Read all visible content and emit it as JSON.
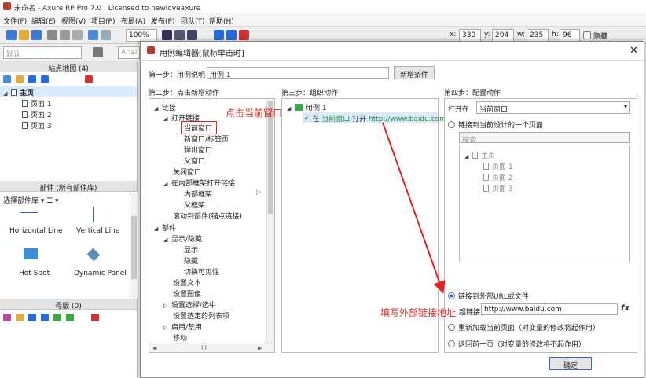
{
  "window": {
    "title": "未命名 - Axure RP Pro 7.0 : Licensed to newloveaxure"
  },
  "menu": [
    "文件(F)",
    "编辑(E)",
    "视图(V)",
    "项目(P)",
    "布局(A)",
    "发布(P)",
    "团队(T)",
    "帮助(H)"
  ],
  "toolbar": {
    "zoom": "100%",
    "x_label": "x:",
    "x": "330",
    "y_label": "y:",
    "y": "204",
    "w_label": "w:",
    "w": "235",
    "h_label": "h:",
    "h": "96",
    "hide_label": "隐藏",
    "style_default": "默认",
    "font": "Arial"
  },
  "sitemap": {
    "title": "站点地图 (4)",
    "root": "主页",
    "pages": [
      "页面 1",
      "页面 2",
      "页面 3"
    ]
  },
  "widgets": {
    "title": "部件 (所有部件库)",
    "library_label": "选择部件库",
    "items": [
      "Horizontal Line",
      "Vertical Line",
      "Hot Spot",
      "Dynamic Panel"
    ]
  },
  "masters": {
    "title": "母版 (0)"
  },
  "dialog": {
    "title": "用例编辑器[鼠标单击时]",
    "step1_label": "第一步：用例说明",
    "case_name": "用例 1",
    "add_condition": "新增条件",
    "step2_title": "第二步：点击新增动作",
    "step3_title": "第三步：组织动作",
    "step4_title": "第四步：配置动作",
    "actions": {
      "link": "链接",
      "open_link": "打开链接",
      "current_window": "当前窗口",
      "new_tab": "新窗口/标签页",
      "popup": "弹出窗口",
      "parent_window": "父窗口",
      "close_window": "关闭窗口",
      "open_in_frame": "在内部框架打开链接",
      "inline_frame": "内部框架",
      "parent_frame": "父框架",
      "scroll_to": "滚动到部件(锚点链接)",
      "widgets": "部件",
      "show_hide": "显示/隐藏",
      "show": "显示",
      "hide": "隐藏",
      "toggle": "切换可见性",
      "set_text": "设置文本",
      "set_image": "设置图像",
      "set_selected": "设置选择/选中",
      "set_list_selected": "设置选定的列表项",
      "enable_disable": "启用/禁用",
      "move": "移动"
    },
    "organize": {
      "case": "用例 1",
      "action_prefix": "在",
      "action_target": "当前窗口",
      "action_mid": "打开",
      "action_url": "http://www.baidu.com"
    },
    "config": {
      "open_in_label": "打开在",
      "open_in_value": "当前窗口",
      "opt_page": "链接到当前设计的一个页面",
      "search_placeholder": "搜索",
      "tree_root": "主页",
      "tree_pages": [
        "页面 1",
        "页面 2",
        "页面 3"
      ],
      "opt_external": "链接到外部URL或文件",
      "url_label": "超链接",
      "url_value": "http://www.baidu.com",
      "fx": "fx",
      "opt_reload": "重新加载当前页面（对变量的修改将起作用）",
      "opt_back": "返回前一页（对变量的修改将不起作用）"
    },
    "ok": "确定",
    "scroll_left": "◀",
    "scroll_mid": "III",
    "scroll_right": "▶"
  },
  "annotations": {
    "click_current": "点击当前窗口",
    "fill_url": "填写外部链接地址"
  },
  "colors": {
    "accent": "#2a6ad8",
    "annotation": "#e02424",
    "selected": "#d9ecff"
  }
}
